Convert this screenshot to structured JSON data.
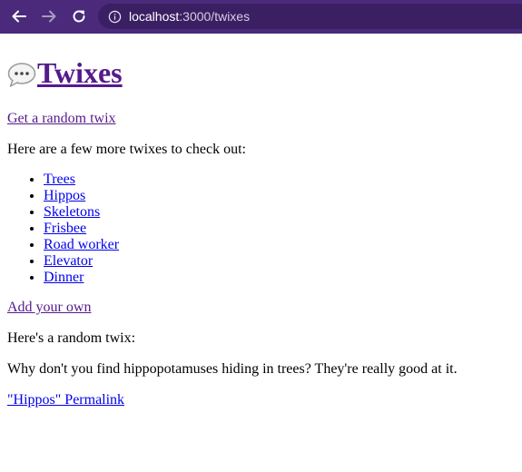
{
  "browser": {
    "url_host": "localhost",
    "url_path": ":3000/twixes",
    "colors": {
      "toolbar": "#4b2a7c",
      "url_field": "#3a1f63"
    },
    "icons": [
      "back-arrow-icon",
      "forward-arrow-icon",
      "reload-icon",
      "info-icon"
    ]
  },
  "page": {
    "title_emoji": "speech-bubble-icon",
    "title": "Twixes",
    "random_link": "Get a random twix",
    "more_text": "Here are a few more twixes to check out:",
    "twixes": [
      "Trees",
      "Hippos",
      "Skeletons",
      "Frisbee",
      "Road worker",
      "Elevator",
      "Dinner"
    ],
    "add_link": "Add your own",
    "random_heading": "Here's a random twix:",
    "joke": "Why don't you find hippopotamuses hiding in trees? They're really good at it.",
    "permalink": "\"Hippos\" Permalink",
    "link_colors": {
      "visited": "#551a8b",
      "unvisited": "#0000ee"
    }
  }
}
